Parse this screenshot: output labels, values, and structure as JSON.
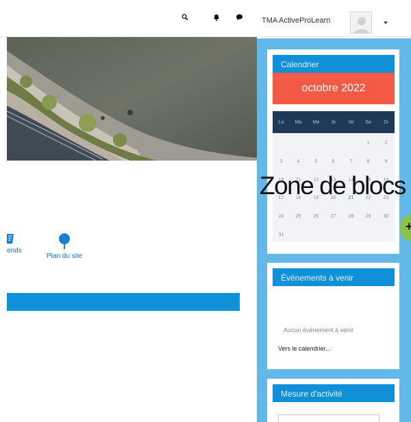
{
  "navbar": {
    "search_icon": "search-icon",
    "notification_icon": "bell-icon",
    "message_icon": "chat-bubble-icon",
    "username": "TMA ActiveProLearn",
    "menu_icon": "caret-down-icon"
  },
  "quick_links": [
    {
      "label": "ends",
      "icon": "book-icon"
    },
    {
      "label": "Plan du site",
      "icon": "map-pin-icon"
    }
  ],
  "blocks": {
    "calendar": {
      "title": "Calendrier",
      "month": "octobre 2022",
      "weekdays": [
        "Lu",
        "Ma",
        "Me",
        "Je",
        "Ve",
        "Sa",
        "Di"
      ],
      "weeks": [
        [
          "",
          "",
          "",
          "",
          "",
          "1",
          "2"
        ],
        [
          "3",
          "4",
          "5",
          "6",
          "7",
          "8",
          "9"
        ],
        [
          "10",
          "11",
          "12",
          "13",
          "14",
          "15",
          "16"
        ],
        [
          "17",
          "18",
          "19",
          "20",
          "21",
          "22",
          "23"
        ],
        [
          "24",
          "25",
          "26",
          "27",
          "28",
          "29",
          "30"
        ],
        [
          "31",
          "",
          "",
          "",
          "",
          "",
          ""
        ]
      ],
      "today": "21"
    },
    "upcoming": {
      "title": "Événements à venir",
      "empty_text": "Aucun événement à venir",
      "link": "Vers le calendrier..."
    },
    "activity": {
      "title": "Mesure d'activité"
    }
  },
  "zone_label": "Zone de blocs",
  "dock_handle": "+",
  "colors": {
    "accent_blue": "#0f90d9",
    "block_zone": "#62b8e8",
    "month_red": "#f25a45",
    "calendar_head": "#1f3a57",
    "dock_green": "#8bc34a"
  }
}
